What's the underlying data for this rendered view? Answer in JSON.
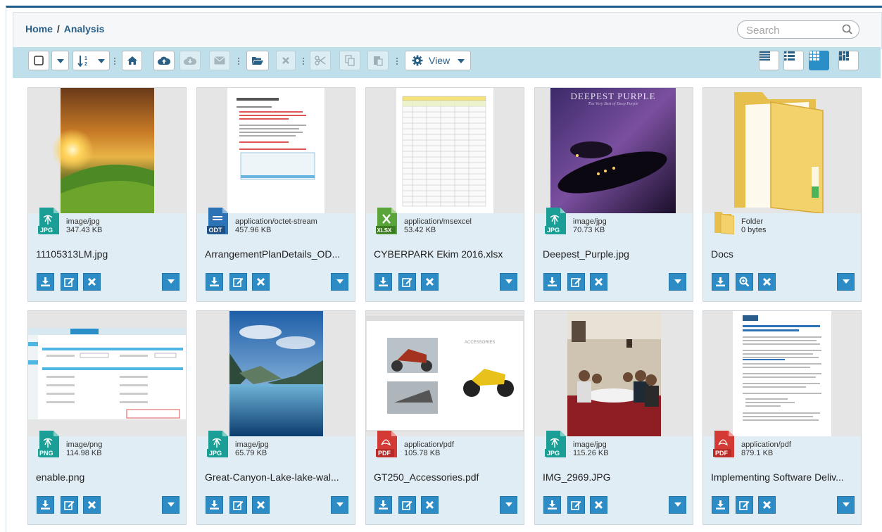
{
  "breadcrumb": {
    "home": "Home",
    "separator": "/",
    "current": "Analysis"
  },
  "search": {
    "placeholder": "Search"
  },
  "toolbar": {
    "view_label": "View"
  },
  "colors": {
    "accent": "#2d8cc5",
    "header_border": "#1f5c8b",
    "toolbar_bg": "#bfdfea",
    "card_bg": "#e1edf4"
  },
  "files": [
    {
      "name": "11105313LM.jpg",
      "type": "image/jpg",
      "size": "347.43 KB",
      "badge": "JPG",
      "icon": "jpg-file-icon"
    },
    {
      "name": "ArrangementPlanDetails_OD...",
      "type": "application/octet-stream",
      "size": "457.96 KB",
      "badge": "ODT",
      "icon": "odt-file-icon"
    },
    {
      "name": "CYBERPARK Ekim 2016.xlsx",
      "type": "application/msexcel",
      "size": "53.42 KB",
      "badge": "XLSX",
      "icon": "xlsx-file-icon"
    },
    {
      "name": "Deepest_Purple.jpg",
      "type": "image/jpg",
      "size": "70.73 KB",
      "badge": "JPG",
      "icon": "jpg-file-icon",
      "thumb_title": "DEEPEST PURPLE",
      "thumb_subtitle": "The Very Best of Deep Purple"
    },
    {
      "name": "Docs",
      "type": "Folder",
      "size": "0 bytes",
      "badge": "",
      "icon": "folder-icon"
    },
    {
      "name": "enable.png",
      "type": "image/png",
      "size": "114.98 KB",
      "badge": "PNG",
      "icon": "png-file-icon"
    },
    {
      "name": "Great-Canyon-Lake-lake-wal...",
      "type": "image/jpg",
      "size": "65.79 KB",
      "badge": "JPG",
      "icon": "jpg-file-icon"
    },
    {
      "name": "GT250_Accessories.pdf",
      "type": "application/pdf",
      "size": "105.78 KB",
      "badge": "PDF",
      "icon": "pdf-file-icon"
    },
    {
      "name": "IMG_2969.JPG",
      "type": "image/jpg",
      "size": "115.26 KB",
      "badge": "JPG",
      "icon": "jpg-file-icon"
    },
    {
      "name": "Implementing Software Deliv...",
      "type": "application/pdf",
      "size": "879.1 KB",
      "badge": "PDF",
      "icon": "pdf-file-icon"
    }
  ]
}
